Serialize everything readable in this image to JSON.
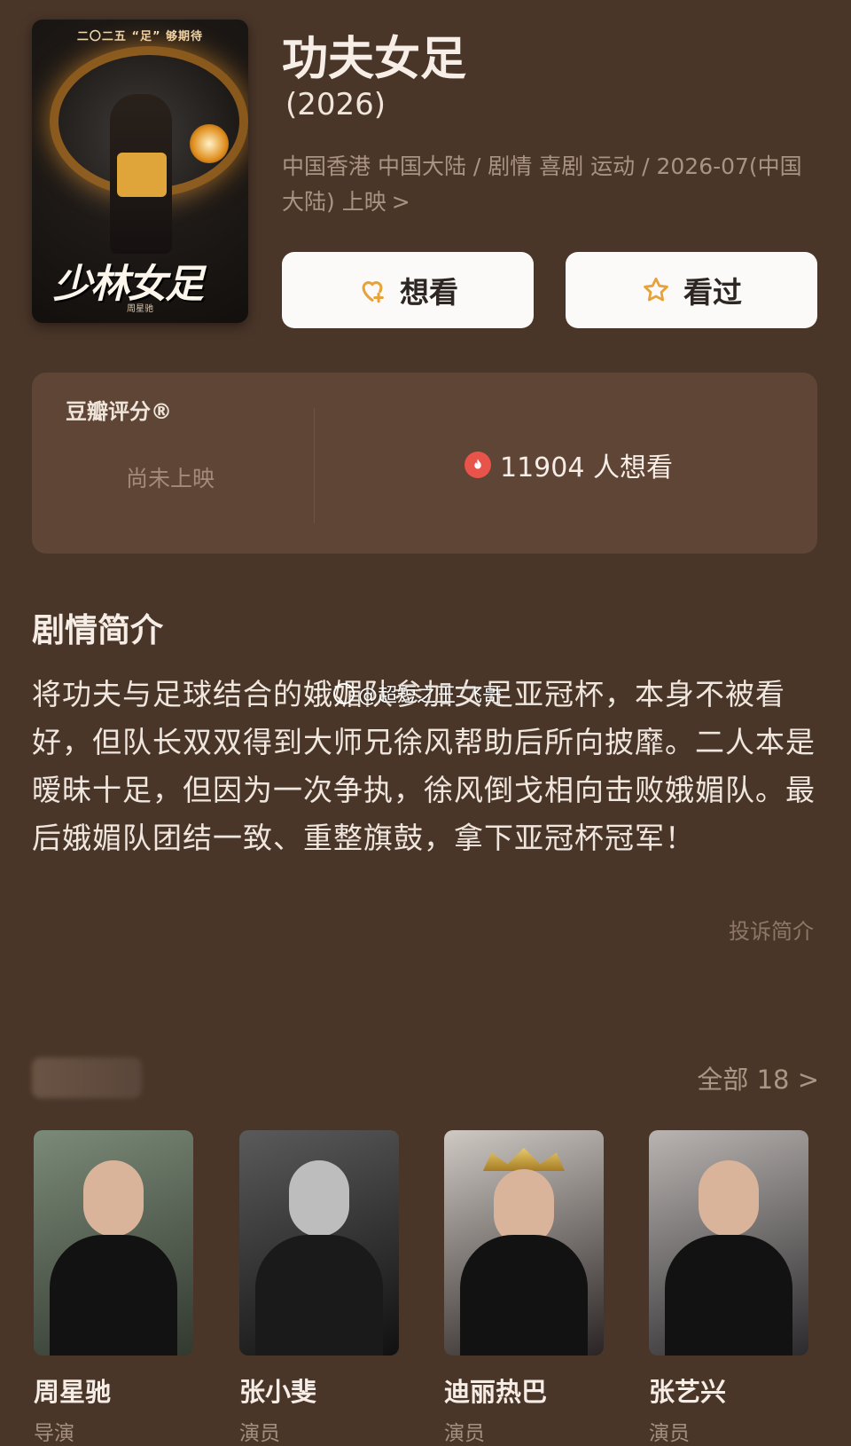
{
  "movie": {
    "poster_top_text": "二〇二五 “足” 够期待",
    "poster_title_art": "少林女足",
    "poster_credit": "周星驰",
    "title": "功夫女足",
    "year": "(2026)",
    "meta": "中国香港 中国大陆 / 剧情 喜剧 运动 / 2026-07(中国大陆) 上映",
    "meta_chevron": ">"
  },
  "actions": {
    "want_label": "想看",
    "seen_label": "看过",
    "accent": "#e8a23a"
  },
  "rating": {
    "label": "豆瓣评分®",
    "status": "尚未上映",
    "want_count_text": "11904 人想看"
  },
  "synopsis": {
    "title": "剧情简介",
    "text": "将功夫与足球结合的娥媚队参加女足亚冠杯，本身不被看好，但队长双双得到大师兄徐风帮助后所向披靡。二人本是暧昧十足，但因为一次争执，徐风倒戈相向击败娥媚队。最后娥媚队团结一致、重整旗鼓，拿下亚冠杯冠军！",
    "report_label": "投诉简介"
  },
  "watermark": "@超短之王-飞哥",
  "cast": {
    "all_label": "全部 18 >",
    "members": [
      {
        "name": "周星驰",
        "role": "导演"
      },
      {
        "name": "张小斐",
        "role": "演员"
      },
      {
        "name": "迪丽热巴",
        "role": "演员"
      },
      {
        "name": "张艺兴",
        "role": "演员"
      }
    ]
  }
}
